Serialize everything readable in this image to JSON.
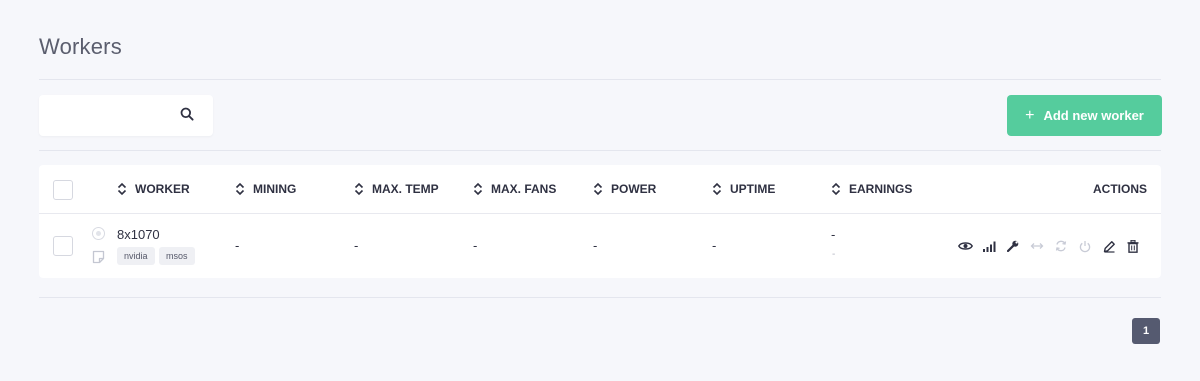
{
  "page": {
    "title": "Workers"
  },
  "search": {
    "value": "",
    "placeholder": ""
  },
  "toolbar": {
    "add_worker_label": "Add new worker",
    "add_icon": "plus-icon"
  },
  "table": {
    "columns": {
      "worker": "WORKER",
      "mining": "MINING",
      "max_temp": "MAX. TEMP",
      "max_fans": "MAX. FANS",
      "power": "POWER",
      "uptime": "UPTIME",
      "earnings": "EARNINGS",
      "actions": "ACTIONS"
    },
    "rows": [
      {
        "name": "8x1070",
        "tags": [
          "nvidia",
          "msos"
        ],
        "mining": "-",
        "max_temp": "-",
        "max_fans": "-",
        "power": "-",
        "uptime": "-",
        "earnings": "-",
        "earnings_sub": "-"
      }
    ],
    "action_icons": [
      "eye-icon",
      "signal-icon",
      "wrench-icon",
      "transfer-icon",
      "sync-icon",
      "power-icon",
      "edit-icon",
      "trash-icon"
    ]
  },
  "pagination": {
    "current_page": "1"
  },
  "colors": {
    "accent": "#55cc9d",
    "pager": "#555a70",
    "background": "#f6f7fb"
  }
}
